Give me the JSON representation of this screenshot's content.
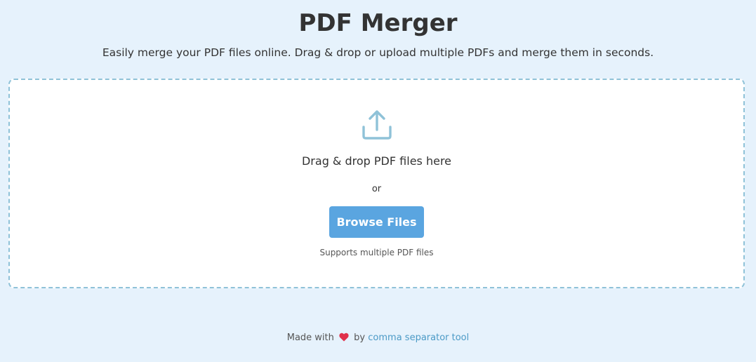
{
  "header": {
    "title": "PDF Merger",
    "subtitle": "Easily merge your PDF files online. Drag & drop or upload multiple PDFs and merge them in seconds."
  },
  "dropzone": {
    "icon": "upload-icon",
    "prompt": "Drag & drop PDF files here",
    "separator": "or",
    "browse_label": "Browse Files",
    "hint": "Supports multiple PDF files"
  },
  "footer": {
    "made_with": "Made with",
    "heart_icon": "heart-icon",
    "by": "by",
    "link_text": "comma separator tool"
  },
  "colors": {
    "background": "#e6f2fc",
    "accent": "#5aa5e0",
    "dropzone_border": "#8fc2d8",
    "link": "#4b9ac6",
    "heart": "#e0314b"
  }
}
